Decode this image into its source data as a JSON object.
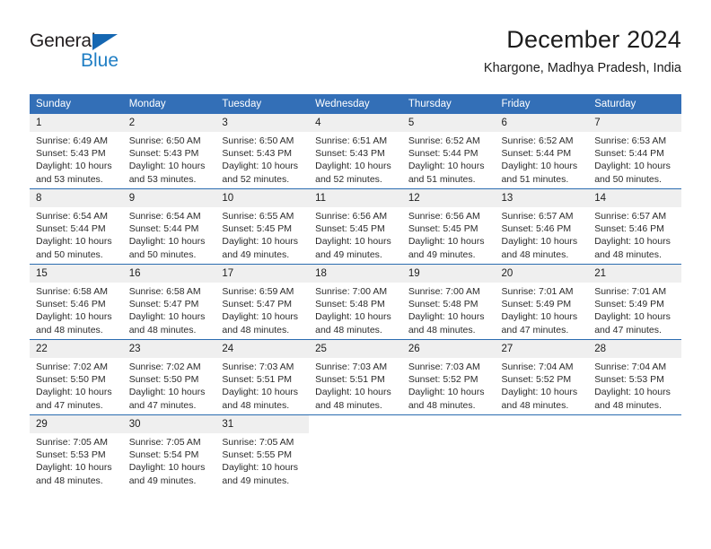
{
  "brand": {
    "line1": "General",
    "line2": "Blue",
    "triangle_icon": "triangle-icon",
    "colors": {
      "text": "#231f20",
      "blue": "#1f7ec4",
      "triangle": "#1567b2"
    }
  },
  "header": {
    "title": "December 2024",
    "location": "Khargone, Madhya Pradesh, India"
  },
  "theme": {
    "header_blue": "#336fb7",
    "separator_blue": "#2b6cb0",
    "daynum_band": "#efefef",
    "body_text": "#2b2b2b"
  },
  "weekdays": [
    "Sunday",
    "Monday",
    "Tuesday",
    "Wednesday",
    "Thursday",
    "Friday",
    "Saturday"
  ],
  "weeks": [
    [
      {
        "day": "1",
        "sunrise": "Sunrise: 6:49 AM",
        "sunset": "Sunset: 5:43 PM",
        "daylight": "Daylight: 10 hours and 53 minutes."
      },
      {
        "day": "2",
        "sunrise": "Sunrise: 6:50 AM",
        "sunset": "Sunset: 5:43 PM",
        "daylight": "Daylight: 10 hours and 53 minutes."
      },
      {
        "day": "3",
        "sunrise": "Sunrise: 6:50 AM",
        "sunset": "Sunset: 5:43 PM",
        "daylight": "Daylight: 10 hours and 52 minutes."
      },
      {
        "day": "4",
        "sunrise": "Sunrise: 6:51 AM",
        "sunset": "Sunset: 5:43 PM",
        "daylight": "Daylight: 10 hours and 52 minutes."
      },
      {
        "day": "5",
        "sunrise": "Sunrise: 6:52 AM",
        "sunset": "Sunset: 5:44 PM",
        "daylight": "Daylight: 10 hours and 51 minutes."
      },
      {
        "day": "6",
        "sunrise": "Sunrise: 6:52 AM",
        "sunset": "Sunset: 5:44 PM",
        "daylight": "Daylight: 10 hours and 51 minutes."
      },
      {
        "day": "7",
        "sunrise": "Sunrise: 6:53 AM",
        "sunset": "Sunset: 5:44 PM",
        "daylight": "Daylight: 10 hours and 50 minutes."
      }
    ],
    [
      {
        "day": "8",
        "sunrise": "Sunrise: 6:54 AM",
        "sunset": "Sunset: 5:44 PM",
        "daylight": "Daylight: 10 hours and 50 minutes."
      },
      {
        "day": "9",
        "sunrise": "Sunrise: 6:54 AM",
        "sunset": "Sunset: 5:44 PM",
        "daylight": "Daylight: 10 hours and 50 minutes."
      },
      {
        "day": "10",
        "sunrise": "Sunrise: 6:55 AM",
        "sunset": "Sunset: 5:45 PM",
        "daylight": "Daylight: 10 hours and 49 minutes."
      },
      {
        "day": "11",
        "sunrise": "Sunrise: 6:56 AM",
        "sunset": "Sunset: 5:45 PM",
        "daylight": "Daylight: 10 hours and 49 minutes."
      },
      {
        "day": "12",
        "sunrise": "Sunrise: 6:56 AM",
        "sunset": "Sunset: 5:45 PM",
        "daylight": "Daylight: 10 hours and 49 minutes."
      },
      {
        "day": "13",
        "sunrise": "Sunrise: 6:57 AM",
        "sunset": "Sunset: 5:46 PM",
        "daylight": "Daylight: 10 hours and 48 minutes."
      },
      {
        "day": "14",
        "sunrise": "Sunrise: 6:57 AM",
        "sunset": "Sunset: 5:46 PM",
        "daylight": "Daylight: 10 hours and 48 minutes."
      }
    ],
    [
      {
        "day": "15",
        "sunrise": "Sunrise: 6:58 AM",
        "sunset": "Sunset: 5:46 PM",
        "daylight": "Daylight: 10 hours and 48 minutes."
      },
      {
        "day": "16",
        "sunrise": "Sunrise: 6:58 AM",
        "sunset": "Sunset: 5:47 PM",
        "daylight": "Daylight: 10 hours and 48 minutes."
      },
      {
        "day": "17",
        "sunrise": "Sunrise: 6:59 AM",
        "sunset": "Sunset: 5:47 PM",
        "daylight": "Daylight: 10 hours and 48 minutes."
      },
      {
        "day": "18",
        "sunrise": "Sunrise: 7:00 AM",
        "sunset": "Sunset: 5:48 PM",
        "daylight": "Daylight: 10 hours and 48 minutes."
      },
      {
        "day": "19",
        "sunrise": "Sunrise: 7:00 AM",
        "sunset": "Sunset: 5:48 PM",
        "daylight": "Daylight: 10 hours and 48 minutes."
      },
      {
        "day": "20",
        "sunrise": "Sunrise: 7:01 AM",
        "sunset": "Sunset: 5:49 PM",
        "daylight": "Daylight: 10 hours and 47 minutes."
      },
      {
        "day": "21",
        "sunrise": "Sunrise: 7:01 AM",
        "sunset": "Sunset: 5:49 PM",
        "daylight": "Daylight: 10 hours and 47 minutes."
      }
    ],
    [
      {
        "day": "22",
        "sunrise": "Sunrise: 7:02 AM",
        "sunset": "Sunset: 5:50 PM",
        "daylight": "Daylight: 10 hours and 47 minutes."
      },
      {
        "day": "23",
        "sunrise": "Sunrise: 7:02 AM",
        "sunset": "Sunset: 5:50 PM",
        "daylight": "Daylight: 10 hours and 47 minutes."
      },
      {
        "day": "24",
        "sunrise": "Sunrise: 7:03 AM",
        "sunset": "Sunset: 5:51 PM",
        "daylight": "Daylight: 10 hours and 48 minutes."
      },
      {
        "day": "25",
        "sunrise": "Sunrise: 7:03 AM",
        "sunset": "Sunset: 5:51 PM",
        "daylight": "Daylight: 10 hours and 48 minutes."
      },
      {
        "day": "26",
        "sunrise": "Sunrise: 7:03 AM",
        "sunset": "Sunset: 5:52 PM",
        "daylight": "Daylight: 10 hours and 48 minutes."
      },
      {
        "day": "27",
        "sunrise": "Sunrise: 7:04 AM",
        "sunset": "Sunset: 5:52 PM",
        "daylight": "Daylight: 10 hours and 48 minutes."
      },
      {
        "day": "28",
        "sunrise": "Sunrise: 7:04 AM",
        "sunset": "Sunset: 5:53 PM",
        "daylight": "Daylight: 10 hours and 48 minutes."
      }
    ],
    [
      {
        "day": "29",
        "sunrise": "Sunrise: 7:05 AM",
        "sunset": "Sunset: 5:53 PM",
        "daylight": "Daylight: 10 hours and 48 minutes."
      },
      {
        "day": "30",
        "sunrise": "Sunrise: 7:05 AM",
        "sunset": "Sunset: 5:54 PM",
        "daylight": "Daylight: 10 hours and 49 minutes."
      },
      {
        "day": "31",
        "sunrise": "Sunrise: 7:05 AM",
        "sunset": "Sunset: 5:55 PM",
        "daylight": "Daylight: 10 hours and 49 minutes."
      },
      {
        "day": "",
        "sunrise": "",
        "sunset": "",
        "daylight": ""
      },
      {
        "day": "",
        "sunrise": "",
        "sunset": "",
        "daylight": ""
      },
      {
        "day": "",
        "sunrise": "",
        "sunset": "",
        "daylight": ""
      },
      {
        "day": "",
        "sunrise": "",
        "sunset": "",
        "daylight": ""
      }
    ]
  ]
}
